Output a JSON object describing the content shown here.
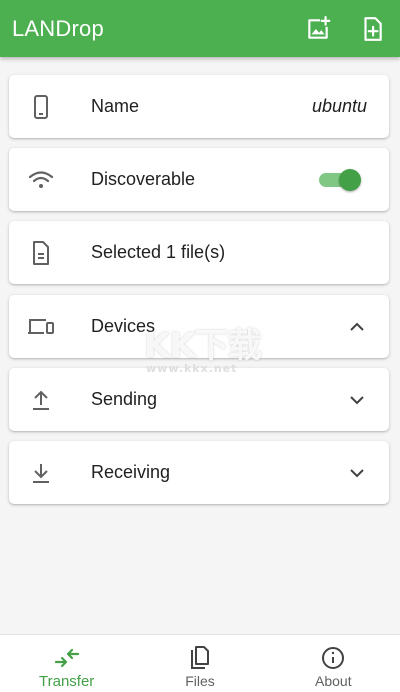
{
  "app": {
    "title": "LANDrop",
    "actions": [
      {
        "icon": "add-photo-icon"
      },
      {
        "icon": "add-file-icon"
      }
    ]
  },
  "colors": {
    "primary": "#4caf50",
    "accent": "#43a047",
    "background": "#f5f5f5",
    "icon": "#616161"
  },
  "cards": {
    "name": {
      "icon": "phone-icon",
      "label": "Name",
      "value": "ubuntu"
    },
    "discoverable": {
      "icon": "wifi-icon",
      "label": "Discoverable",
      "enabled": true
    },
    "selected": {
      "icon": "document-icon",
      "label": "Selected 1 file(s)"
    },
    "devices": {
      "icon": "devices-icon",
      "label": "Devices",
      "expanded": true
    },
    "sending": {
      "icon": "upload-icon",
      "label": "Sending",
      "expanded": false
    },
    "receiving": {
      "icon": "download-icon",
      "label": "Receiving",
      "expanded": false
    }
  },
  "watermark": {
    "text": "KK下载",
    "url": "www.kkx.net"
  },
  "bottom_nav": {
    "items": [
      {
        "label": "Transfer",
        "icon": "swap-arrows-icon",
        "active": true
      },
      {
        "label": "Files",
        "icon": "files-icon",
        "active": false
      },
      {
        "label": "About",
        "icon": "info-icon",
        "active": false
      }
    ]
  }
}
